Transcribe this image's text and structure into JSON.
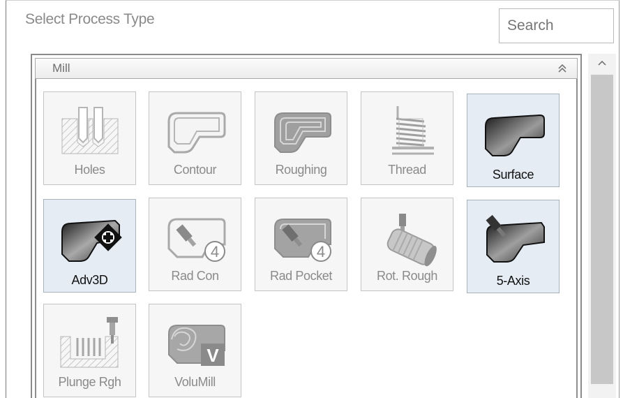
{
  "dialog": {
    "title": "Select Process Type",
    "search_placeholder": "Search"
  },
  "group": {
    "name": "Mill"
  },
  "tiles": [
    {
      "label": "Holes",
      "icon": "holes-icon",
      "selected": false
    },
    {
      "label": "Contour",
      "icon": "contour-icon",
      "selected": false
    },
    {
      "label": "Roughing",
      "icon": "roughing-icon",
      "selected": false
    },
    {
      "label": "Thread",
      "icon": "thread-icon",
      "selected": false
    },
    {
      "label": "Surface",
      "icon": "surface-icon",
      "selected": true
    },
    {
      "label": "Adv3D",
      "icon": "adv3d-icon",
      "selected": true
    },
    {
      "label": "Rad Con",
      "icon": "rad-con-icon",
      "selected": false,
      "badge": "4"
    },
    {
      "label": "Rad Pocket",
      "icon": "rad-pocket-icon",
      "selected": false,
      "badge": "4"
    },
    {
      "label": "Rot. Rough",
      "icon": "rot-rough-icon",
      "selected": false
    },
    {
      "label": "5-Axis",
      "icon": "five-axis-icon",
      "selected": true
    },
    {
      "label": "Plunge Rgh",
      "icon": "plunge-rough-icon",
      "selected": false
    },
    {
      "label": "VoluMill",
      "icon": "volumill-icon",
      "selected": false,
      "badge": "V"
    }
  ],
  "colors": {
    "selected_bg": "#e5ecf4",
    "tile_bg": "#f6f6f6",
    "disabled_text": "#8a8a8a"
  }
}
